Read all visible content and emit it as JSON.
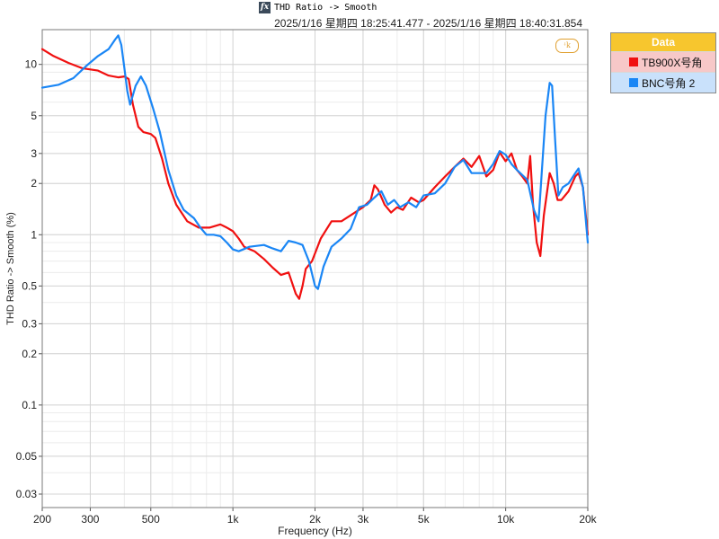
{
  "window": {
    "title": "THD Ratio -> Smooth",
    "subtitle": "2025/1/16 星期四 18:25:41.477 - 2025/1/16 星期四 18:40:31.854"
  },
  "toolbar": {
    "fx_label": "fx"
  },
  "logo": {
    "text": "ꜜk"
  },
  "legend": {
    "header": "Data",
    "items": [
      {
        "label": "TB900X号角",
        "color": "#f01010"
      },
      {
        "label": "BNC号角 2",
        "color": "#1a86f5"
      }
    ]
  },
  "chart_data": {
    "type": "line",
    "xlabel": "Frequency (Hz)",
    "ylabel": "THD Ratio -> Smooth (%)",
    "x_scale": "log",
    "y_scale": "log",
    "xlim": [
      200,
      20000
    ],
    "ylim": [
      0.025,
      16
    ],
    "x_ticks": [
      {
        "v": 200,
        "label": "200"
      },
      {
        "v": 300,
        "label": "300"
      },
      {
        "v": 500,
        "label": "500"
      },
      {
        "v": 1000,
        "label": "1k"
      },
      {
        "v": 2000,
        "label": "2k"
      },
      {
        "v": 3000,
        "label": "3k"
      },
      {
        "v": 5000,
        "label": "5k"
      },
      {
        "v": 10000,
        "label": "10k"
      },
      {
        "v": 20000,
        "label": "20k"
      }
    ],
    "y_ticks": [
      {
        "v": 10,
        "label": "10"
      },
      {
        "v": 5,
        "label": "5"
      },
      {
        "v": 3,
        "label": "3"
      },
      {
        "v": 2,
        "label": "2"
      },
      {
        "v": 1,
        "label": "1"
      },
      {
        "v": 0.5,
        "label": "0.5"
      },
      {
        "v": 0.3,
        "label": "0.3"
      },
      {
        "v": 0.2,
        "label": "0.2"
      },
      {
        "v": 0.1,
        "label": "0.1"
      },
      {
        "v": 0.05,
        "label": "0.05"
      },
      {
        "v": 0.03,
        "label": "0.03"
      }
    ],
    "grid": true,
    "legend_position": "right",
    "series": [
      {
        "name": "TB900X号角",
        "color": "#f01010",
        "points": [
          [
            200,
            12.3
          ],
          [
            220,
            11.2
          ],
          [
            250,
            10.2
          ],
          [
            280,
            9.5
          ],
          [
            320,
            9.2
          ],
          [
            350,
            8.6
          ],
          [
            380,
            8.4
          ],
          [
            400,
            8.5
          ],
          [
            415,
            8.2
          ],
          [
            430,
            5.8
          ],
          [
            450,
            4.3
          ],
          [
            470,
            4.0
          ],
          [
            500,
            3.9
          ],
          [
            520,
            3.7
          ],
          [
            550,
            2.8
          ],
          [
            580,
            2.0
          ],
          [
            620,
            1.5
          ],
          [
            680,
            1.2
          ],
          [
            750,
            1.1
          ],
          [
            820,
            1.1
          ],
          [
            900,
            1.15
          ],
          [
            950,
            1.1
          ],
          [
            1000,
            1.05
          ],
          [
            1050,
            0.95
          ],
          [
            1100,
            0.85
          ],
          [
            1200,
            0.8
          ],
          [
            1300,
            0.72
          ],
          [
            1400,
            0.64
          ],
          [
            1500,
            0.58
          ],
          [
            1600,
            0.6
          ],
          [
            1700,
            0.45
          ],
          [
            1750,
            0.42
          ],
          [
            1800,
            0.5
          ],
          [
            1850,
            0.63
          ],
          [
            1950,
            0.7
          ],
          [
            2100,
            0.95
          ],
          [
            2300,
            1.2
          ],
          [
            2500,
            1.2
          ],
          [
            2700,
            1.3
          ],
          [
            3000,
            1.45
          ],
          [
            3200,
            1.6
          ],
          [
            3300,
            1.95
          ],
          [
            3400,
            1.85
          ],
          [
            3600,
            1.5
          ],
          [
            3800,
            1.35
          ],
          [
            4000,
            1.45
          ],
          [
            4200,
            1.4
          ],
          [
            4500,
            1.65
          ],
          [
            4800,
            1.55
          ],
          [
            5000,
            1.6
          ],
          [
            5500,
            1.9
          ],
          [
            6000,
            2.2
          ],
          [
            6500,
            2.5
          ],
          [
            7000,
            2.8
          ],
          [
            7500,
            2.5
          ],
          [
            8000,
            2.9
          ],
          [
            8500,
            2.2
          ],
          [
            9000,
            2.4
          ],
          [
            9500,
            3.05
          ],
          [
            10000,
            2.7
          ],
          [
            10500,
            3.0
          ],
          [
            11000,
            2.4
          ],
          [
            11500,
            2.2
          ],
          [
            12000,
            2.0
          ],
          [
            12300,
            2.9
          ],
          [
            12600,
            1.5
          ],
          [
            13000,
            0.9
          ],
          [
            13400,
            0.75
          ],
          [
            13800,
            1.3
          ],
          [
            14500,
            2.3
          ],
          [
            15000,
            2.0
          ],
          [
            15500,
            1.6
          ],
          [
            16000,
            1.6
          ],
          [
            17000,
            1.8
          ],
          [
            18000,
            2.2
          ],
          [
            18500,
            2.3
          ],
          [
            19200,
            1.9
          ],
          [
            20000,
            1.0
          ]
        ]
      },
      {
        "name": "BNC号角 2",
        "color": "#1a86f5",
        "points": [
          [
            200,
            7.3
          ],
          [
            230,
            7.6
          ],
          [
            260,
            8.3
          ],
          [
            290,
            9.8
          ],
          [
            320,
            11.2
          ],
          [
            350,
            12.3
          ],
          [
            370,
            14.0
          ],
          [
            380,
            14.8
          ],
          [
            390,
            13.0
          ],
          [
            400,
            9.5
          ],
          [
            410,
            7.0
          ],
          [
            420,
            5.8
          ],
          [
            440,
            7.5
          ],
          [
            460,
            8.5
          ],
          [
            480,
            7.5
          ],
          [
            510,
            5.5
          ],
          [
            540,
            4.0
          ],
          [
            580,
            2.4
          ],
          [
            620,
            1.7
          ],
          [
            660,
            1.4
          ],
          [
            720,
            1.25
          ],
          [
            760,
            1.1
          ],
          [
            800,
            1.0
          ],
          [
            850,
            1.0
          ],
          [
            900,
            0.98
          ],
          [
            950,
            0.9
          ],
          [
            1000,
            0.82
          ],
          [
            1050,
            0.8
          ],
          [
            1150,
            0.85
          ],
          [
            1300,
            0.87
          ],
          [
            1400,
            0.83
          ],
          [
            1500,
            0.8
          ],
          [
            1600,
            0.92
          ],
          [
            1700,
            0.9
          ],
          [
            1800,
            0.87
          ],
          [
            1900,
            0.7
          ],
          [
            2000,
            0.5
          ],
          [
            2050,
            0.48
          ],
          [
            2150,
            0.65
          ],
          [
            2300,
            0.85
          ],
          [
            2500,
            0.95
          ],
          [
            2700,
            1.08
          ],
          [
            2900,
            1.45
          ],
          [
            3100,
            1.5
          ],
          [
            3300,
            1.65
          ],
          [
            3500,
            1.8
          ],
          [
            3700,
            1.5
          ],
          [
            3900,
            1.6
          ],
          [
            4100,
            1.45
          ],
          [
            4400,
            1.55
          ],
          [
            4700,
            1.45
          ],
          [
            5000,
            1.7
          ],
          [
            5500,
            1.75
          ],
          [
            6000,
            2.0
          ],
          [
            6500,
            2.5
          ],
          [
            7000,
            2.75
          ],
          [
            7500,
            2.3
          ],
          [
            8000,
            2.3
          ],
          [
            8500,
            2.3
          ],
          [
            9000,
            2.6
          ],
          [
            9500,
            3.1
          ],
          [
            10000,
            2.95
          ],
          [
            10500,
            2.6
          ],
          [
            11000,
            2.4
          ],
          [
            12000,
            2.1
          ],
          [
            12700,
            1.4
          ],
          [
            13200,
            1.2
          ],
          [
            13600,
            2.5
          ],
          [
            14000,
            5.0
          ],
          [
            14500,
            7.8
          ],
          [
            14800,
            7.5
          ],
          [
            15200,
            3.5
          ],
          [
            15600,
            1.7
          ],
          [
            16200,
            1.9
          ],
          [
            17000,
            2.0
          ],
          [
            18000,
            2.3
          ],
          [
            18500,
            2.45
          ],
          [
            19200,
            1.9
          ],
          [
            20000,
            0.9
          ]
        ]
      }
    ]
  }
}
